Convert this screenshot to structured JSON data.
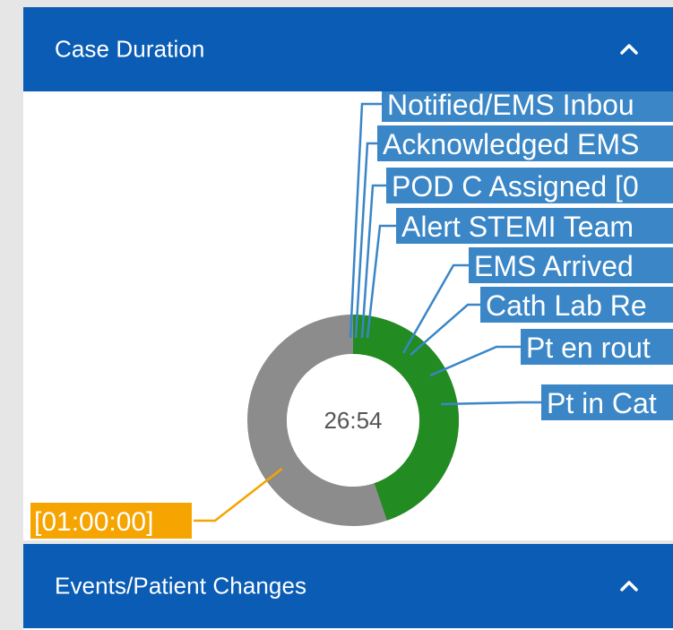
{
  "colors": {
    "header_bg": "#0a5cb4",
    "label_bg": "#3a86c6",
    "elapsed": "#228b22",
    "remaining": "#8c8c8c",
    "highlight": "#f5a400"
  },
  "panels": {
    "case_duration": {
      "title": "Case Duration",
      "toggle_icon": "chevron-up-icon"
    },
    "events": {
      "title": "Events/Patient Changes",
      "toggle_icon": "chevron-up-icon"
    }
  },
  "chart_data": {
    "type": "pie",
    "center_label": "26:54",
    "total_label": "[01:00:00]",
    "elapsed_fraction": 0.448,
    "events": [
      {
        "label": "Notified/EMS Inbou"
      },
      {
        "label": "Acknowledged EMS"
      },
      {
        "label": "POD C Assigned [0"
      },
      {
        "label": "Alert STEMI Team"
      },
      {
        "label": "EMS Arrived"
      },
      {
        "label": "Cath Lab Re"
      },
      {
        "label": "Pt en rout"
      },
      {
        "label": "Pt in Cat"
      }
    ]
  }
}
